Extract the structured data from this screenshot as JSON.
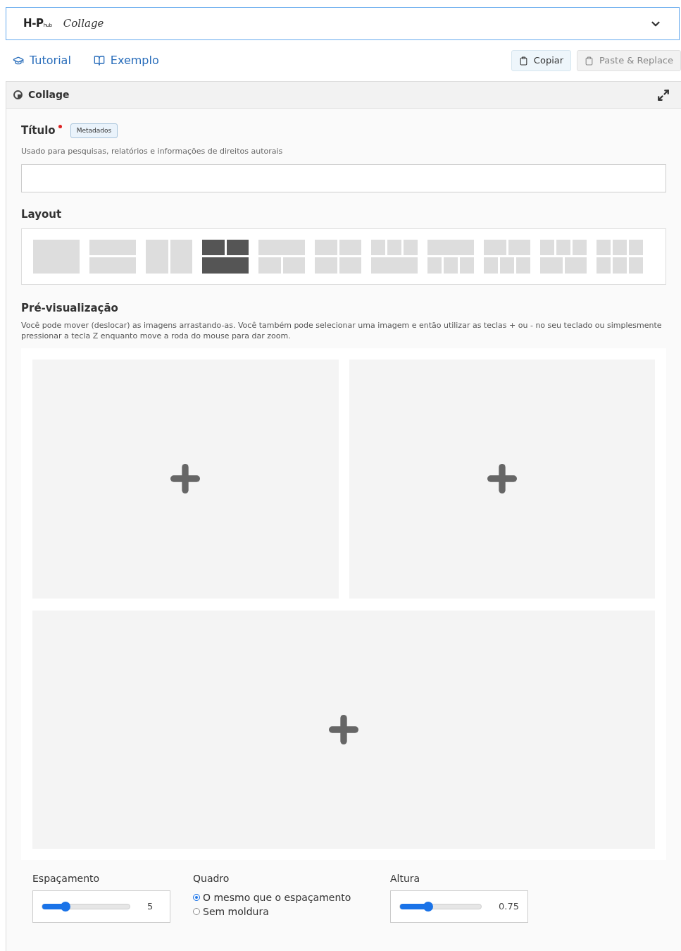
{
  "selector": {
    "logo": "H-P",
    "logo_suffix": "hub",
    "value": "Collage"
  },
  "links": [
    {
      "kind": "tutorial",
      "label": "Tutorial"
    },
    {
      "kind": "example",
      "label": "Exemplo"
    }
  ],
  "actions": [
    {
      "label": "Copiar",
      "disabled": false
    },
    {
      "label": "Paste & Replace",
      "disabled": true
    }
  ],
  "panel": {
    "title": "Collage"
  },
  "title_field": {
    "label": "Título",
    "required": true,
    "badge": "Metadados",
    "description": "Usado para pesquisas, relatórios e informações de direitos autorais"
  },
  "layout": {
    "label": "Layout",
    "options": [
      {
        "kind": "one",
        "selected": false
      },
      {
        "kind": "one-one",
        "selected": false
      },
      {
        "kind": "two",
        "selected": false
      },
      {
        "kind": "two-one",
        "selected": true
      },
      {
        "kind": "one-two",
        "selected": false
      },
      {
        "kind": "two-two",
        "selected": false
      },
      {
        "kind": "three-one",
        "selected": false
      },
      {
        "kind": "one-three",
        "selected": false
      },
      {
        "kind": "two-three",
        "selected": false
      },
      {
        "kind": "three-two",
        "selected": false
      },
      {
        "kind": "three-three",
        "selected": false
      }
    ]
  },
  "preview": {
    "label": "Pré-visualização",
    "description": "Você pode mover (deslocar) as imagens arrastando-as. Você também pode selecionar uma imagem e então utilizar as teclas + ou - no seu teclado ou simplesmente pressionar a tecla Z enquanto move a roda do mouse para dar zoom."
  },
  "spacing": {
    "label": "Espaçamento",
    "level": 0.27,
    "reading": "5"
  },
  "frame": {
    "label": "Quadro",
    "options": [
      {
        "label": "O mesmo que o espaçamento",
        "selected": true
      },
      {
        "label": "Sem moldura",
        "selected": false
      }
    ]
  },
  "height": {
    "label": "Altura",
    "level": 0.35,
    "reading": "0.75"
  }
}
